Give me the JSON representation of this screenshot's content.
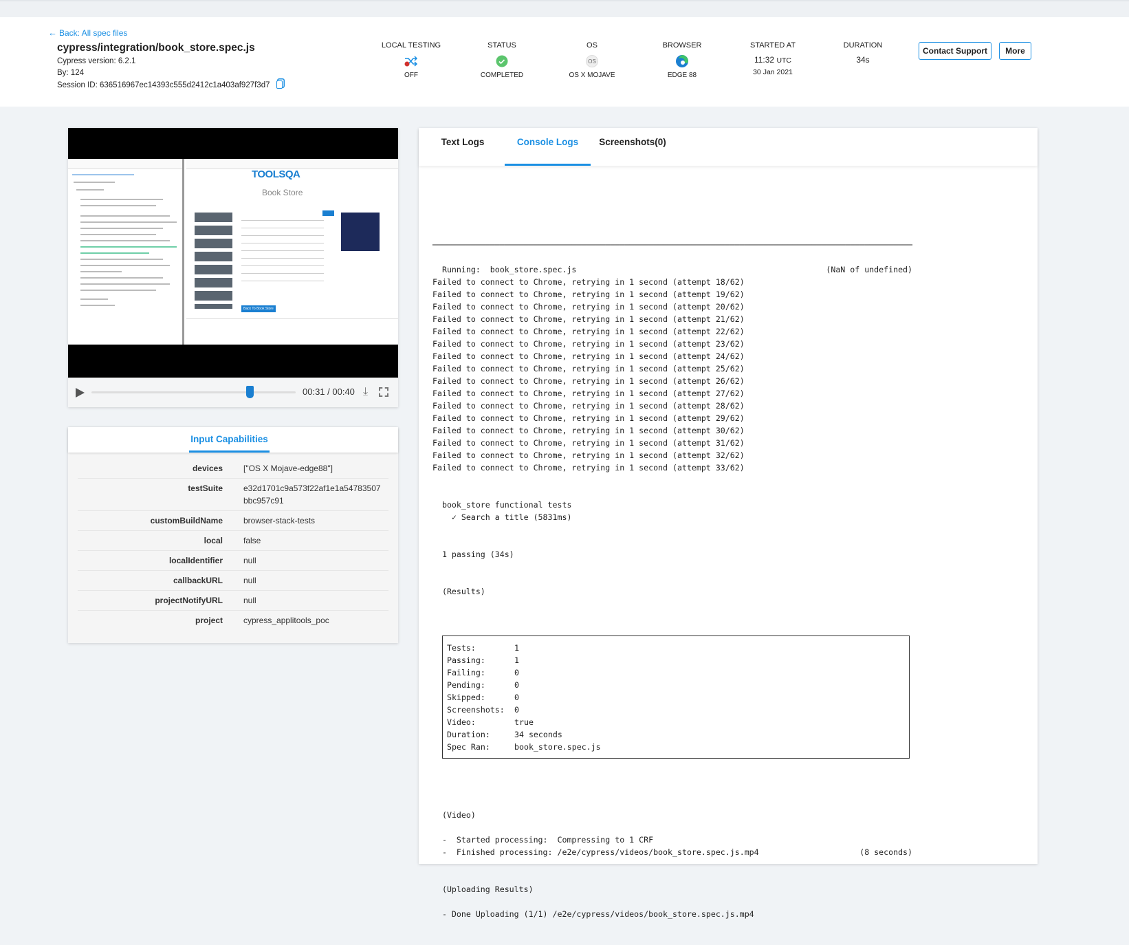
{
  "header": {
    "back_link": "Back: All spec files",
    "title": "cypress/integration/book_store.spec.js",
    "cypress_version": "Cypress version: 6.2.1",
    "by": "By: 124",
    "session_id": "Session ID: 636516967ec14393c555d2412c1a403af927f3d7",
    "columns": [
      {
        "label": "LOCAL TESTING",
        "value": "OFF",
        "icon": "shuffle-icon"
      },
      {
        "label": "STATUS",
        "value": "COMPLETED",
        "icon": "check-circle-icon"
      },
      {
        "label": "OS",
        "value": "OS X MOJAVE",
        "icon": "os-icon",
        "icon_text": "OS"
      },
      {
        "label": "BROWSER",
        "value": "EDGE 88",
        "icon": "edge-icon"
      },
      {
        "label": "STARTED AT",
        "time": "11:32",
        "tz": "UTC",
        "date": "30 Jan 2021"
      },
      {
        "label": "DURATION",
        "value": "34s"
      }
    ],
    "contact_support": "Contact Support",
    "more": "More"
  },
  "video": {
    "current_time": "00:31",
    "total_time": "00:40",
    "time_display": "00:31 / 00:40",
    "progress": 0.775,
    "thumb": {
      "brand": "TOOLSQA",
      "page_title": "Book Store",
      "back_button": "Back To Book Store"
    }
  },
  "capabilities": {
    "tab": "Input Capabilities",
    "rows": [
      {
        "key": "devices",
        "value": "[\"OS X Mojave-edge88\"]"
      },
      {
        "key": "testSuite",
        "value": "e32d1701c9a573f22af1e1a54783507bbc957c91"
      },
      {
        "key": "customBuildName",
        "value": "browser-stack-tests"
      },
      {
        "key": "local",
        "value": "false"
      },
      {
        "key": "localIdentifier",
        "value": "null"
      },
      {
        "key": "callbackURL",
        "value": "null"
      },
      {
        "key": "projectNotifyURL",
        "value": "null"
      },
      {
        "key": "project",
        "value": "cypress_applitools_poc"
      }
    ]
  },
  "logs": {
    "tabs": [
      {
        "label": "Text Logs",
        "active": false
      },
      {
        "label": "Console Logs",
        "active": true
      },
      {
        "label": "Screenshots(0)",
        "active": false
      }
    ],
    "before_box": [
      "",
      "────────────────────────────────────────────────────────────────────────────────────────────────────",
      "",
      "  Running:  book_store.spec.js                                                    (NaN of undefined)",
      "Failed to connect to Chrome, retrying in 1 second (attempt 18/62)",
      "Failed to connect to Chrome, retrying in 1 second (attempt 19/62)",
      "Failed to connect to Chrome, retrying in 1 second (attempt 20/62)",
      "Failed to connect to Chrome, retrying in 1 second (attempt 21/62)",
      "Failed to connect to Chrome, retrying in 1 second (attempt 22/62)",
      "Failed to connect to Chrome, retrying in 1 second (attempt 23/62)",
      "Failed to connect to Chrome, retrying in 1 second (attempt 24/62)",
      "Failed to connect to Chrome, retrying in 1 second (attempt 25/62)",
      "Failed to connect to Chrome, retrying in 1 second (attempt 26/62)",
      "Failed to connect to Chrome, retrying in 1 second (attempt 27/62)",
      "Failed to connect to Chrome, retrying in 1 second (attempt 28/62)",
      "Failed to connect to Chrome, retrying in 1 second (attempt 29/62)",
      "Failed to connect to Chrome, retrying in 1 second (attempt 30/62)",
      "Failed to connect to Chrome, retrying in 1 second (attempt 31/62)",
      "Failed to connect to Chrome, retrying in 1 second (attempt 32/62)",
      "Failed to connect to Chrome, retrying in 1 second (attempt 33/62)",
      "",
      "",
      "  book_store functional tests",
      "    ✓ Search a title (5831ms)",
      "",
      "",
      "  1 passing (34s)",
      "",
      "",
      "  (Results)",
      ""
    ],
    "results": [
      {
        "label": "Tests:",
        "value": "1"
      },
      {
        "label": "Passing:",
        "value": "1"
      },
      {
        "label": "Failing:",
        "value": "0"
      },
      {
        "label": "Pending:",
        "value": "0"
      },
      {
        "label": "Skipped:",
        "value": "0"
      },
      {
        "label": "Screenshots:",
        "value": "0"
      },
      {
        "label": "Video:",
        "value": "true"
      },
      {
        "label": "Duration:",
        "value": "34 seconds"
      },
      {
        "label": "Spec Ran:",
        "value": "book_store.spec.js"
      }
    ],
    "after_box": [
      "",
      "",
      "  (Video)",
      "",
      "  -  Started processing:  Compressing to 1 CRF",
      "  -  Finished processing: /e2e/cypress/videos/book_store.spec.js.mp4                     (8 seconds)",
      "",
      "",
      "  (Uploading Results)",
      "",
      "  - Done Uploading (1/1) /e2e/cypress/videos/book_store.spec.js.mp4"
    ]
  },
  "colors": {
    "accent": "#1a8fe3",
    "success": "#5cc56d",
    "danger": "#d0312d",
    "background": "#f0f3f6"
  }
}
